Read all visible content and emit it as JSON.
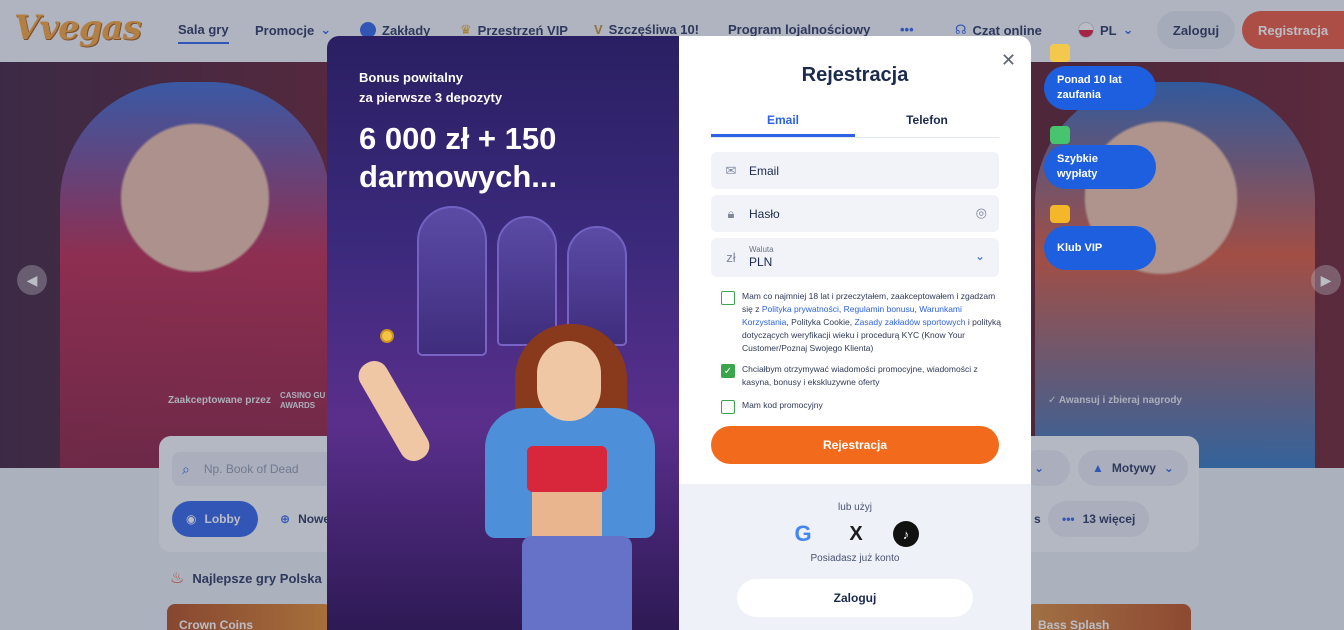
{
  "header": {
    "logo": "Vvegas",
    "nav": [
      {
        "label": "Sala gry"
      },
      {
        "label": "Promocje"
      },
      {
        "label": "Zakłady"
      },
      {
        "label": "Przestrzeń VIP"
      },
      {
        "label": "Szczęśliwa 10!"
      },
      {
        "label": "Program lojalnościowy"
      }
    ],
    "more": "•••",
    "chat": "Czat online",
    "language": "PL",
    "login": "Zaloguj",
    "register": "Registracja"
  },
  "hero": {
    "caption_left": "Zaakceptowane przez",
    "awards": "CASINO GU\nAWARDS",
    "caption_right": "Awansuj i zbieraj nagrody",
    "check": "✓"
  },
  "lobby": {
    "search_placeholder": "Np. Book of Dead",
    "lobby_chip": "Lobby",
    "nowe_chip": "Nowe",
    "motywy": "Motywy",
    "more_chip": "13 więcej",
    "s_chip": "s",
    "best_title": "Najlepsze gry Polska",
    "tile_left": "Crown Coins",
    "tile_right": "Bass Splash"
  },
  "badges": [
    {
      "label": "Ponad 10 lat\nzaufania"
    },
    {
      "label": "Szybkie\nwypłaty"
    },
    {
      "label": "Klub VIP"
    }
  ],
  "promo": {
    "subtitle": "Bonus powitalny\nza pierwsze 3 depozyty",
    "headline": "6 000 zł + 150\ndarmowych..."
  },
  "form": {
    "title": "Rejestracja",
    "tabs": [
      "Email",
      "Telefon"
    ],
    "email_placeholder": "Email",
    "password_placeholder": "Hasło",
    "currency_label": "Waluta",
    "currency_value": "PLN",
    "currency_symbol": "zł",
    "consent_18": {
      "pre": "Mam co najmniej 18 lat i przeczytałem, zaakceptowałem i zgadzam się z ",
      "link1": "Polityka prywatności",
      "sep1": ", ",
      "link2": "Regulamin bonusu",
      "sep2": ", ",
      "link3": "Warunkami Korzystania",
      "mid": ", Polityka Cookie, ",
      "link4": "Zasady zakładów sportowych",
      "post": " i polityką dotyczących weryfikacji wieku i procedurą KYC (Know Your Customer/Poznaj Swojego Klienta)",
      "checked": false
    },
    "consent_marketing": {
      "text": "Chciałbym otrzymywać wiadomości promocyjne, wiadomości z kasyna, bonusy i ekskluzywne oferty",
      "checked": true
    },
    "promo_code": {
      "text": "Mam kod promocyjny",
      "checked": false
    },
    "submit": "Rejestracja",
    "or_use": "lub użyj",
    "social": [
      "G",
      "X",
      "♪"
    ],
    "have_account": "Posiadasz już konto",
    "login": "Zaloguj",
    "close": "✕"
  },
  "colors": {
    "accent_blue": "#2d62e6",
    "cta_orange": "#f26b1d",
    "register_red": "#e8553c",
    "check_green": "#3aa54a"
  }
}
